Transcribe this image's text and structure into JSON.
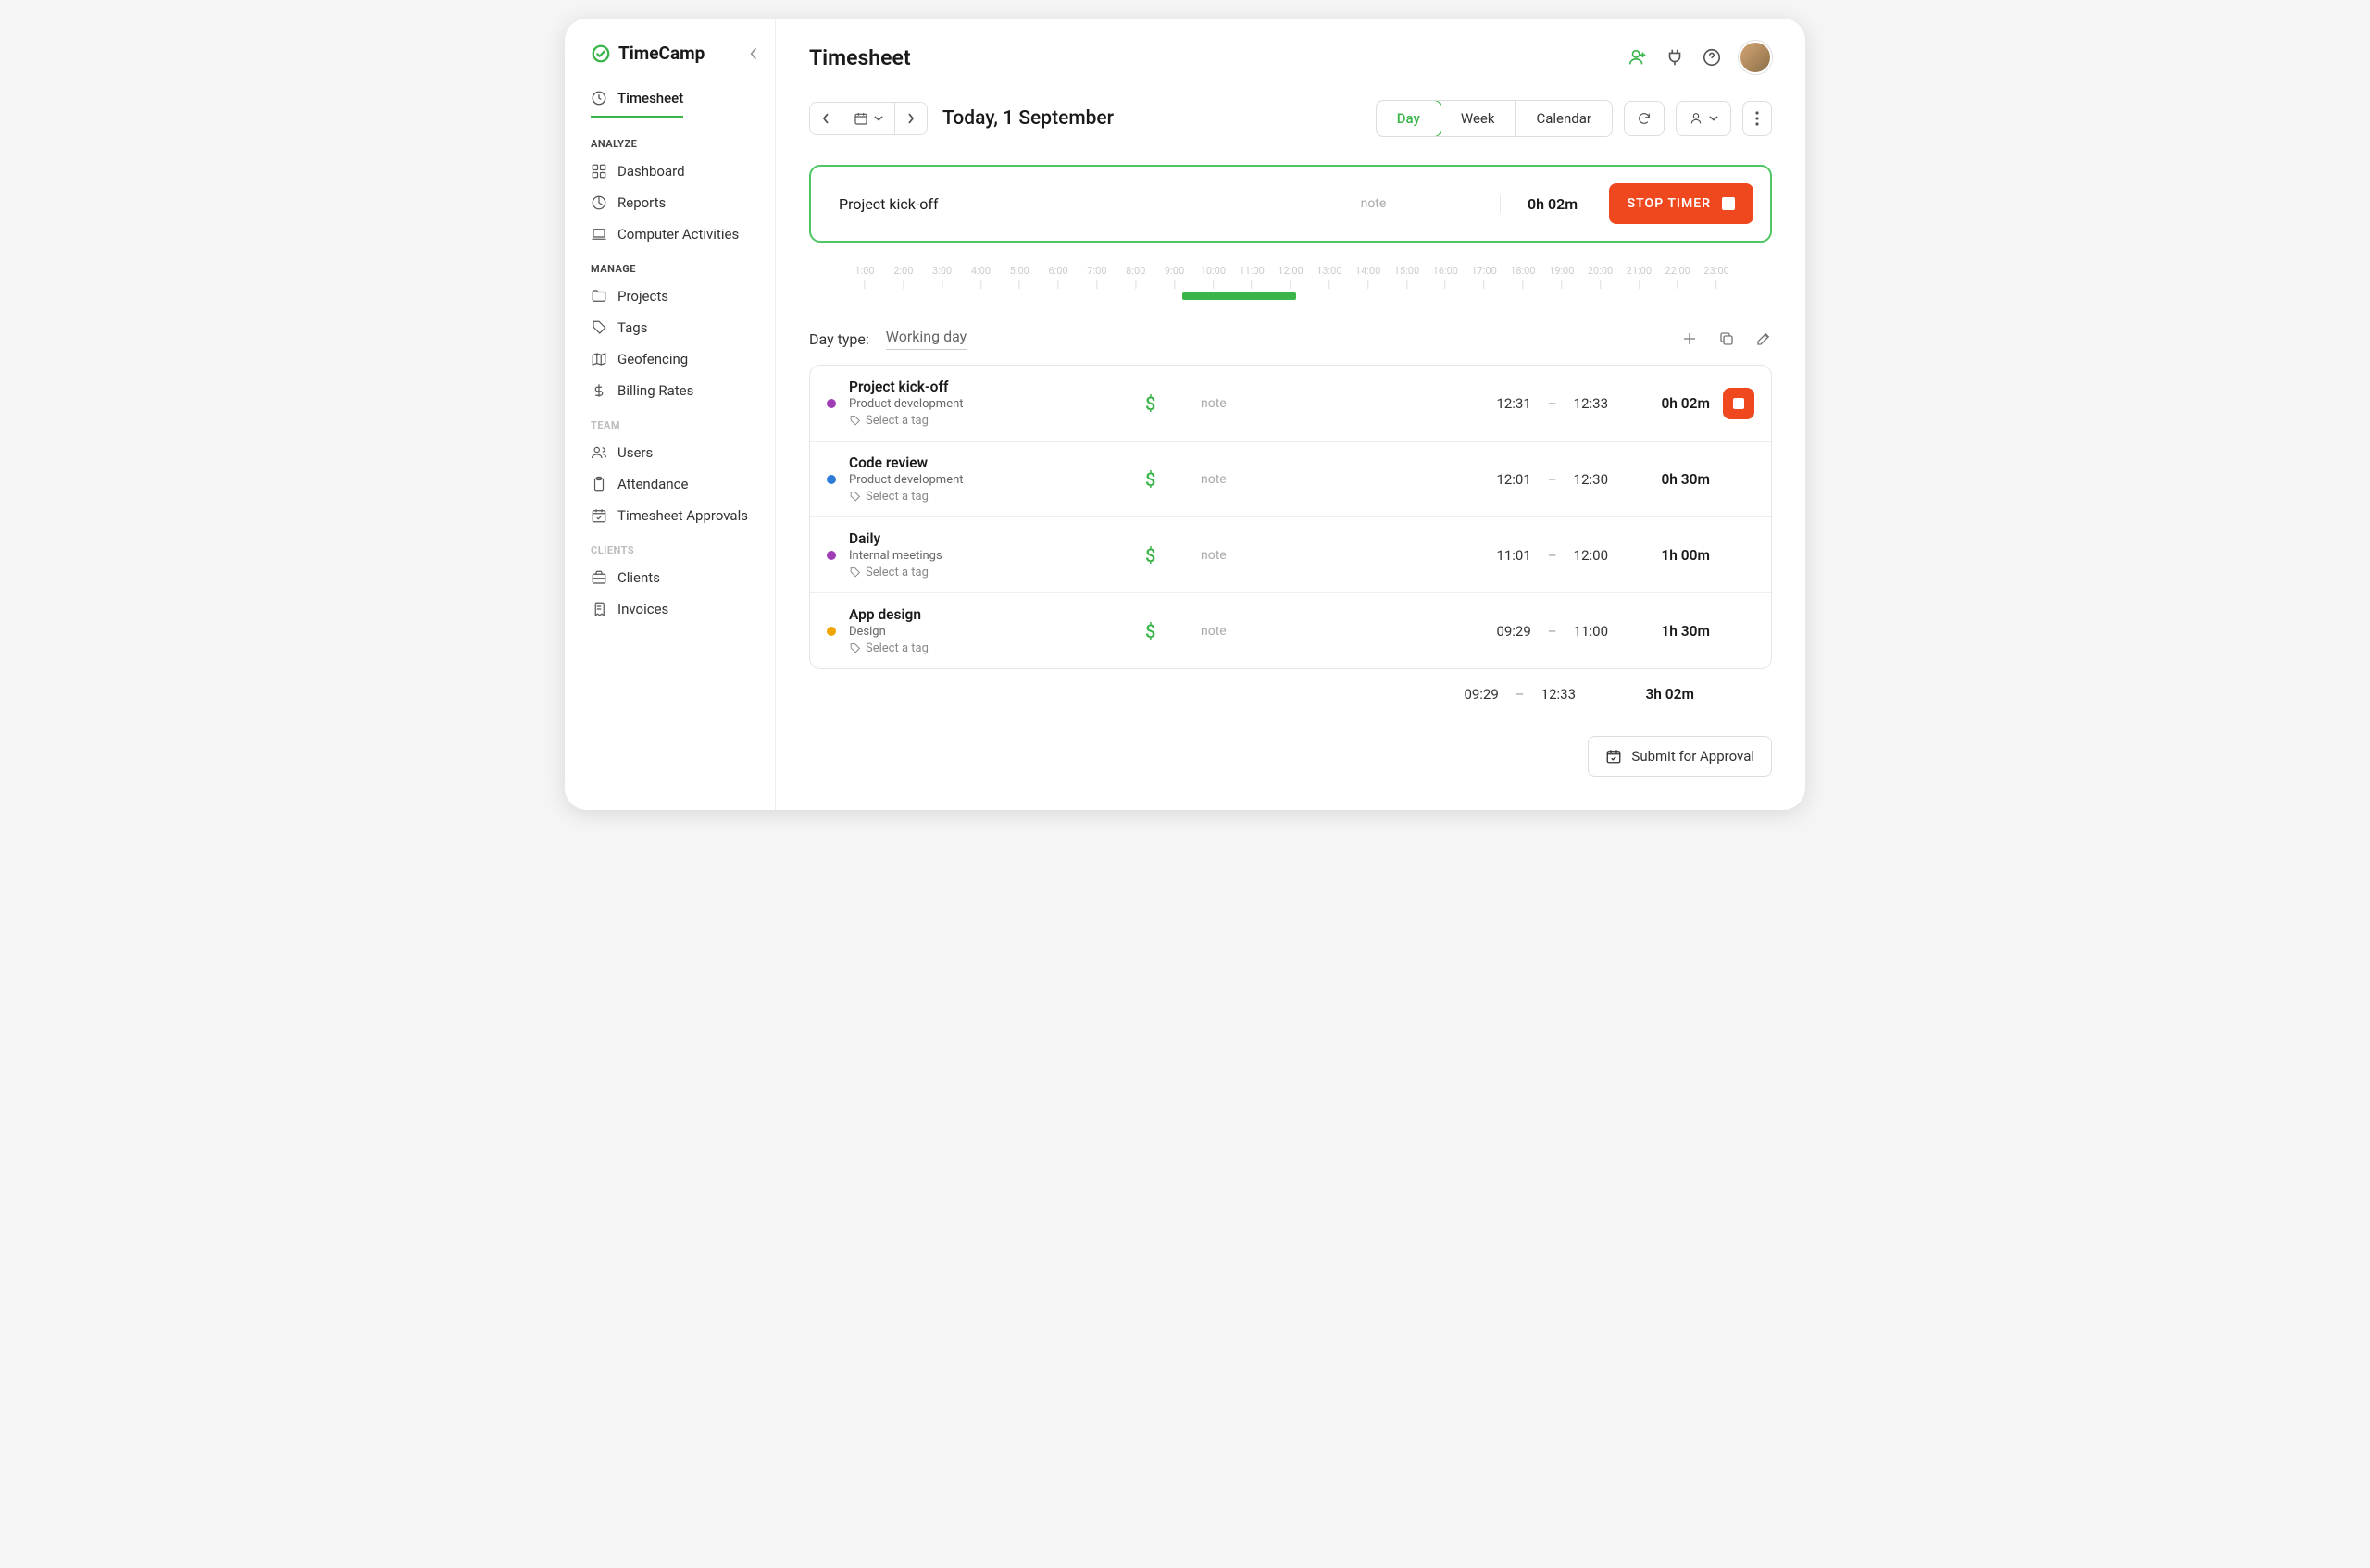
{
  "brand": "TimeCamp",
  "sidebar": {
    "primary": {
      "label": "Timesheet"
    },
    "sections": [
      {
        "title": "ANALYZE",
        "muted": false,
        "items": [
          {
            "label": "Dashboard",
            "icon": "dashboard"
          },
          {
            "label": "Reports",
            "icon": "reports"
          },
          {
            "label": "Computer Activities",
            "icon": "laptop"
          }
        ]
      },
      {
        "title": "MANAGE",
        "muted": false,
        "items": [
          {
            "label": "Projects",
            "icon": "folder"
          },
          {
            "label": "Tags",
            "icon": "tag"
          },
          {
            "label": "Geofencing",
            "icon": "map"
          },
          {
            "label": "Billing Rates",
            "icon": "dollar"
          }
        ]
      },
      {
        "title": "TEAM",
        "muted": true,
        "items": [
          {
            "label": "Users",
            "icon": "users"
          },
          {
            "label": "Attendance",
            "icon": "clipboard"
          },
          {
            "label": "Timesheet Approvals",
            "icon": "calendar-check"
          }
        ]
      },
      {
        "title": "CLIENTS",
        "muted": true,
        "items": [
          {
            "label": "Clients",
            "icon": "briefcase"
          },
          {
            "label": "Invoices",
            "icon": "invoice"
          }
        ]
      }
    ]
  },
  "header": {
    "title": "Timesheet"
  },
  "toolbar": {
    "date_label": "Today, 1 September",
    "views": {
      "day": "Day",
      "week": "Week",
      "calendar": "Calendar"
    }
  },
  "timer": {
    "task": "Project kick-off",
    "note_placeholder": "note",
    "duration": "0h 02m",
    "stop_label": "STOP TIMER"
  },
  "timeline": {
    "hours": [
      "1:00",
      "2:00",
      "3:00",
      "4:00",
      "5:00",
      "6:00",
      "7:00",
      "8:00",
      "9:00",
      "10:00",
      "11:00",
      "12:00",
      "13:00",
      "14:00",
      "15:00",
      "16:00",
      "17:00",
      "18:00",
      "19:00",
      "20:00",
      "21:00",
      "22:00",
      "23:00"
    ],
    "bar_start_pct": 37.3,
    "bar_width_pct": 13.4
  },
  "daytype": {
    "label": "Day type:",
    "value": "Working day"
  },
  "entries": [
    {
      "title": "Project kick-off",
      "project": "Product development",
      "tag": "Select a tag",
      "note": "note",
      "start": "12:31",
      "end": "12:33",
      "duration": "0h 02m",
      "color": "#a03db5",
      "running": true
    },
    {
      "title": "Code review",
      "project": "Product development",
      "tag": "Select a tag",
      "note": "note",
      "start": "12:01",
      "end": "12:30",
      "duration": "0h 30m",
      "color": "#2e7bd6",
      "running": false
    },
    {
      "title": "Daily",
      "project": "Internal meetings",
      "tag": "Select a tag",
      "note": "note",
      "start": "11:01",
      "end": "12:00",
      "duration": "1h 00m",
      "color": "#a03db5",
      "running": false
    },
    {
      "title": "App design",
      "project": "Design",
      "tag": "Select a tag",
      "note": "note",
      "start": "09:29",
      "end": "11:00",
      "duration": "1h 30m",
      "color": "#f0a500",
      "running": false
    }
  ],
  "totals": {
    "start": "09:29",
    "end": "12:33",
    "duration": "3h 02m"
  },
  "submit_label": "Submit for Approval"
}
